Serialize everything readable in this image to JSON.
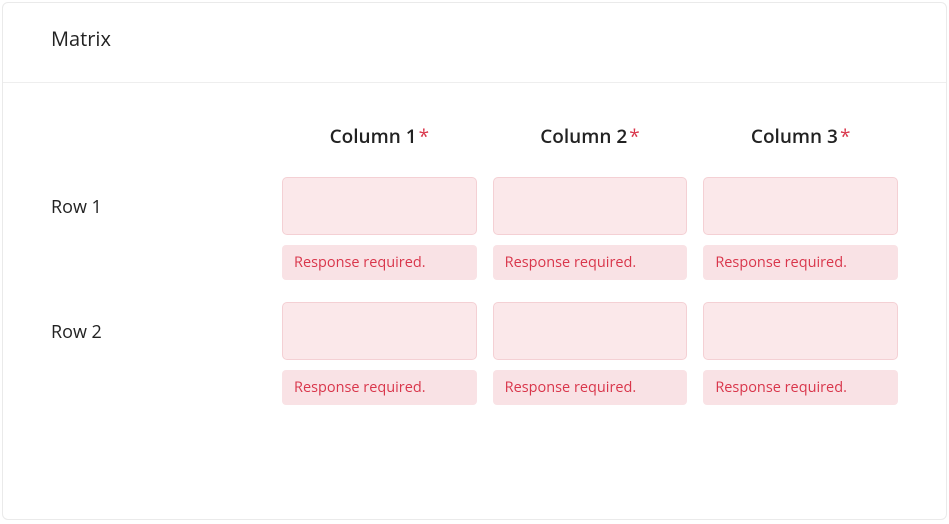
{
  "title": "Matrix",
  "required_mark": "*",
  "columns": [
    {
      "label": "Column 1"
    },
    {
      "label": "Column 2"
    },
    {
      "label": "Column 3"
    }
  ],
  "rows": [
    {
      "label": "Row 1"
    },
    {
      "label": "Row 2"
    }
  ],
  "error_message": "Response required.",
  "cells": {
    "r0c0": {
      "value": "",
      "error": "Response required."
    },
    "r0c1": {
      "value": "",
      "error": "Response required."
    },
    "r0c2": {
      "value": "",
      "error": "Response required."
    },
    "r1c0": {
      "value": "",
      "error": "Response required."
    },
    "r1c1": {
      "value": "",
      "error": "Response required."
    },
    "r1c2": {
      "value": "",
      "error": "Response required."
    }
  }
}
